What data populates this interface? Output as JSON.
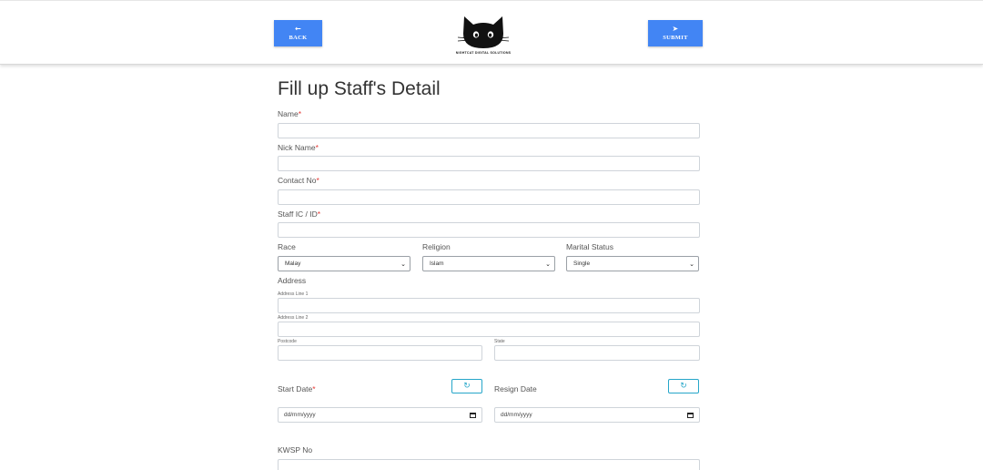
{
  "header": {
    "back": {
      "label": "BACK",
      "icon": "arrow-left-icon"
    },
    "submit": {
      "label": "SUBMIT",
      "icon": "send-icon"
    },
    "logo_text": "NIGHTCAT DIGITAL SOLUTIONS"
  },
  "form": {
    "title": "Fill up Staff's Detail",
    "required_mark": "*",
    "name_label": "Name",
    "nickname_label": "Nick Name",
    "contact_label": "Contact No",
    "staff_id_label": "Staff IC / ID",
    "race": {
      "label": "Race",
      "selected": "Malay"
    },
    "religion": {
      "label": "Religion",
      "selected": "Islam"
    },
    "marital": {
      "label": "Marital Status",
      "selected": "Single"
    },
    "address": {
      "label": "Address",
      "line1_label": "Address Line 1",
      "line2_label": "Address Line 2",
      "postcode_label": "Postcode",
      "state_label": "State"
    },
    "start_date": {
      "label": "Start Date",
      "placeholder": "dd/mm/yyyy"
    },
    "resign_date": {
      "label": "Resign Date",
      "placeholder": "dd/mm/yyyy"
    },
    "kwsp_label": "KWSP No"
  },
  "colors": {
    "primary": "#4285f4",
    "info": "#26a6c9",
    "required": "#e53935"
  }
}
